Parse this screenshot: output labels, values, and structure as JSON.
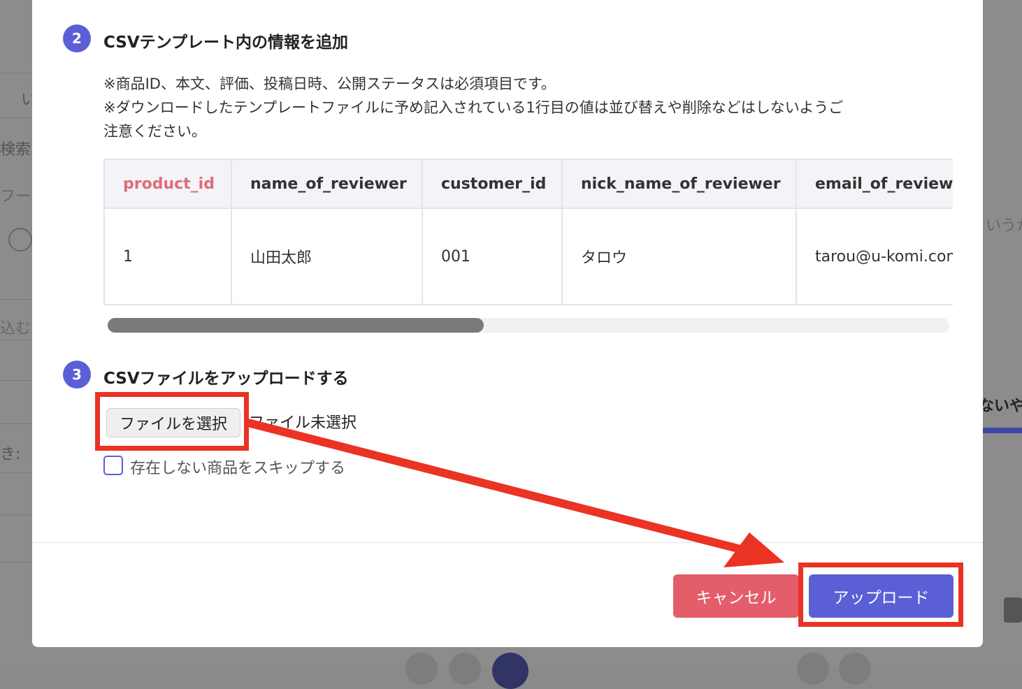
{
  "background": {
    "left_fragments": [
      "い",
      "検索:",
      "フー",
      "込む",
      "き:"
    ],
    "right_fragments": [
      "いうか",
      "ないや"
    ]
  },
  "step2": {
    "number": "2",
    "title": "CSVテンプレート内の情報を追加",
    "notes": [
      "※商品ID、本文、評価、投稿日時、公開ステータスは必須項目です。",
      "※ダウンロードしたテンプレートファイルに予め記入されている1行目の値は並び替えや削除などはしないようご",
      "注意ください。"
    ]
  },
  "table": {
    "headers": [
      "product_id",
      "name_of_reviewer",
      "customer_id",
      "nick_name_of_reviewer",
      "email_of_reviewer"
    ],
    "rows": [
      [
        "1",
        "山田太郎",
        "001",
        "タロウ",
        "tarou@u-komi.com"
      ]
    ]
  },
  "step3": {
    "number": "3",
    "title": "CSVファイルをアップロードする",
    "file_button": "ファイルを選択",
    "file_status": "ファイル未選択",
    "skip_label": "存在しない商品をスキップする"
  },
  "footer": {
    "cancel": "キャンセル",
    "upload": "アップロード"
  },
  "colors": {
    "accent": "#5b5fd6",
    "cancel": "#e35d6a",
    "required_header": "#e06c75",
    "annotation": "#ea3323"
  }
}
